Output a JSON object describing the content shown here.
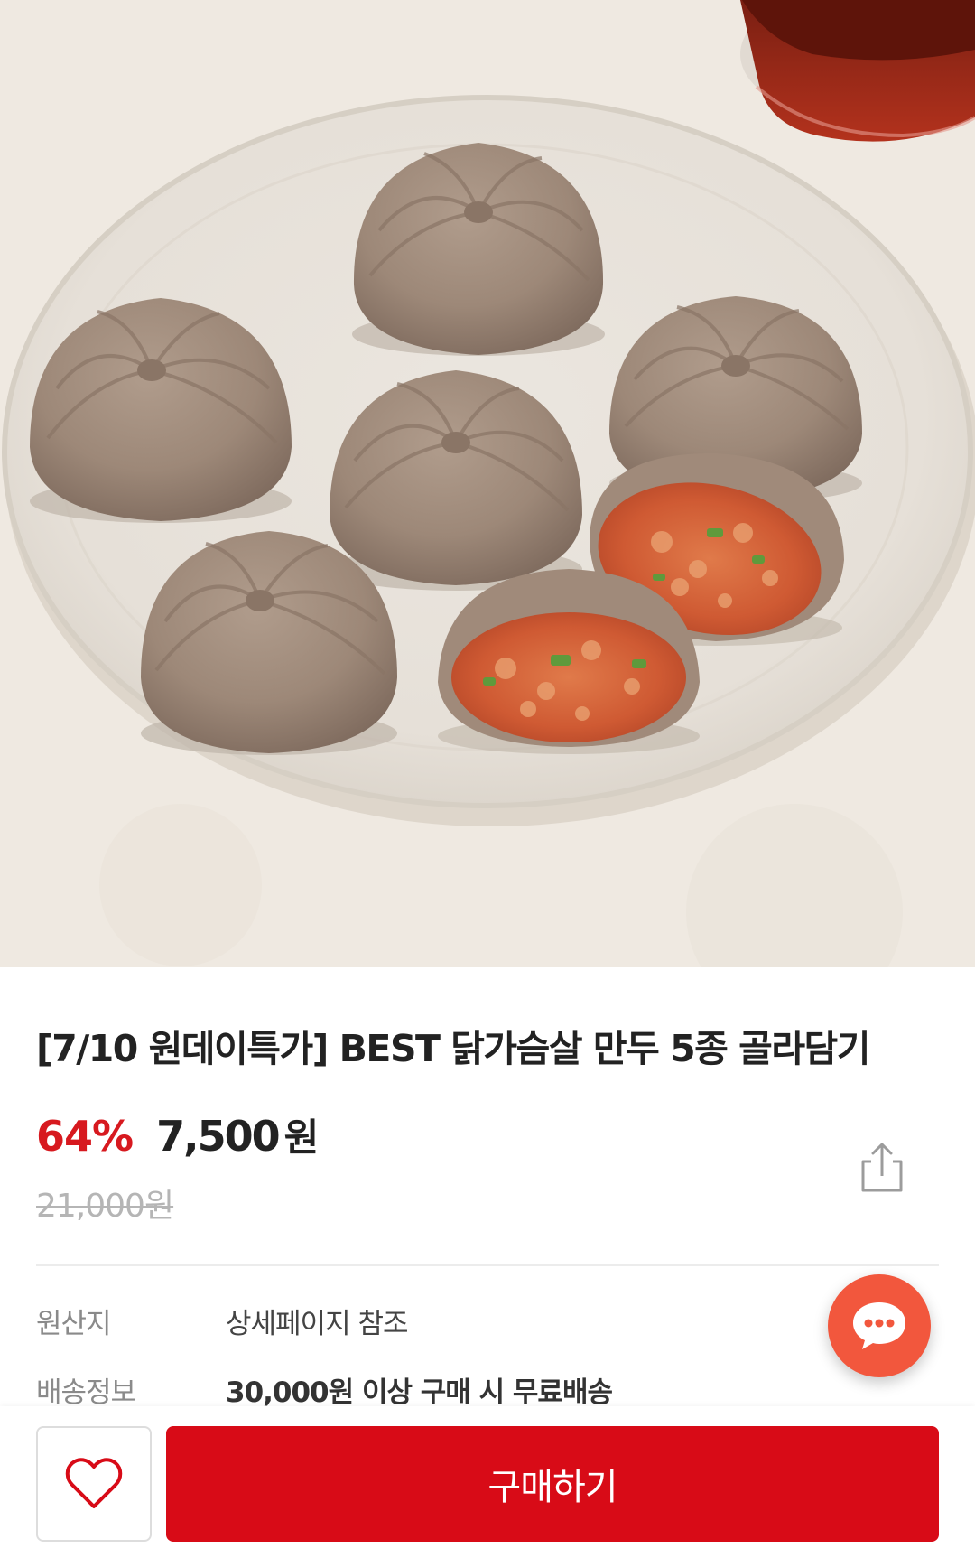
{
  "product": {
    "title": "[7/10 원데이특가] BEST 닭가슴살 만두 5종 골라담기",
    "discount_rate": "64%",
    "sale_price": "7,500",
    "price_unit": "원",
    "original_price": "21,000원"
  },
  "info": {
    "origin_label": "원산지",
    "origin_value": "상세페이지 참조",
    "shipping_label": "배송정보",
    "shipping_value": "30,000원 이상 구매 시 무료배송"
  },
  "bottom_bar": {
    "buy_label": "구매하기"
  },
  "icons": {
    "share": "share-icon",
    "chat": "chat-bubble-icon",
    "wishlist": "heart-outline-icon"
  },
  "colors": {
    "accent_red": "#d80b17",
    "discount_red": "#d7191f",
    "chat_orange": "#f2573d"
  }
}
